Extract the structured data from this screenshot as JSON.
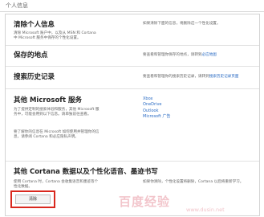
{
  "header": {
    "title": "个人信息"
  },
  "sections": {
    "clear_info": {
      "title": "清除个人信息",
      "left_desc": "清除 Microsoft 账户中，以及从 MSN 和 Cortana 中 Microsoft 服务中保存的个性化设置。",
      "right_desc": "如果清除下面的信息，将删除这一个性化设置。"
    },
    "saved_places": {
      "title": "保存的地点",
      "right_desc": "要查看和管理你保存的地点，请转到",
      "link": "必应地图"
    },
    "search_history": {
      "title": "搜索历史记录",
      "right_desc": "要查看和管理你的搜索历史记录，请转到",
      "link": "搜索历史记录页面"
    },
    "other_services": {
      "title": "其他 Microsoft 服务",
      "desc1": "为了提供定制的搜索体验和服务，其他 Microsoft 服务中，可能会用到以下信息。请单独前往查看。",
      "desc2": "要了解你的信息在 Microsoft 如何使用并管理你的信息，请参阅 Cortana 和必应隐私声明。",
      "desc2_link": "必应隐私声明",
      "links": [
        "Xbox",
        "OneDrive",
        "Outlook",
        "Microsoft 广告"
      ]
    },
    "cortana": {
      "title": "其他 Cortana 数据以及个性化语音、墨迹书写",
      "desc": "使用 Cortana 时，Cortana 会收集语音和墨迹等个性化数据。",
      "right_desc": "如果你清除，个性化设置将删除，Cortana 以后将重新学习。"
    }
  },
  "clear_button": {
    "label": "清除"
  },
  "watermark": {
    "text": "百度经验",
    "url": "www.dusin.net"
  }
}
